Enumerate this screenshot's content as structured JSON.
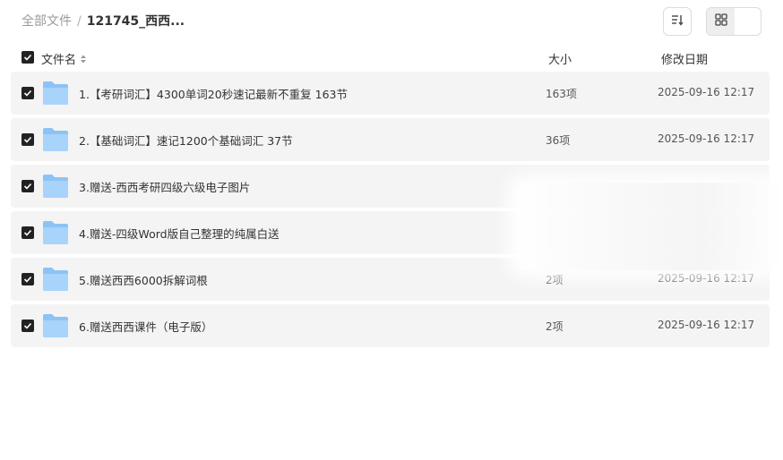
{
  "breadcrumb": {
    "root": "全部文件",
    "separator": "/",
    "current": "121745_西西..."
  },
  "toolbar": {
    "sort_icon": "sort-icon",
    "list_view_icon": "list-view-icon",
    "grid_view_icon": "grid-view-icon",
    "active_view": "grid"
  },
  "table": {
    "headers": {
      "name": "文件名",
      "size": "大小",
      "date": "修改日期"
    },
    "rows": [
      {
        "name": "1.【考研词汇】4300单词20秒速记最新不重复 163节",
        "size": "163项",
        "date": "2025-09-16 12:17"
      },
      {
        "name": "2.【基础词汇】速记1200个基础词汇 37节",
        "size": "36项",
        "date": "2025-09-16 12:17"
      },
      {
        "name": "3.赠送-西西考研四级六级电子图片",
        "size": "",
        "date": ""
      },
      {
        "name": "4.赠送-四级Word版自己整理的纯属白送",
        "size": "",
        "date": ""
      },
      {
        "name": "5.赠送西西6000拆解词根",
        "size": "2项",
        "date": "2025-09-16 12:17"
      },
      {
        "name": "6.赠送西西课件（电子版）",
        "size": "2项",
        "date": "2025-09-16 12:17"
      }
    ]
  },
  "colors": {
    "row_bg": "#f4f4f4",
    "checkbox": "#222222",
    "folder": "#7cb8f0"
  }
}
